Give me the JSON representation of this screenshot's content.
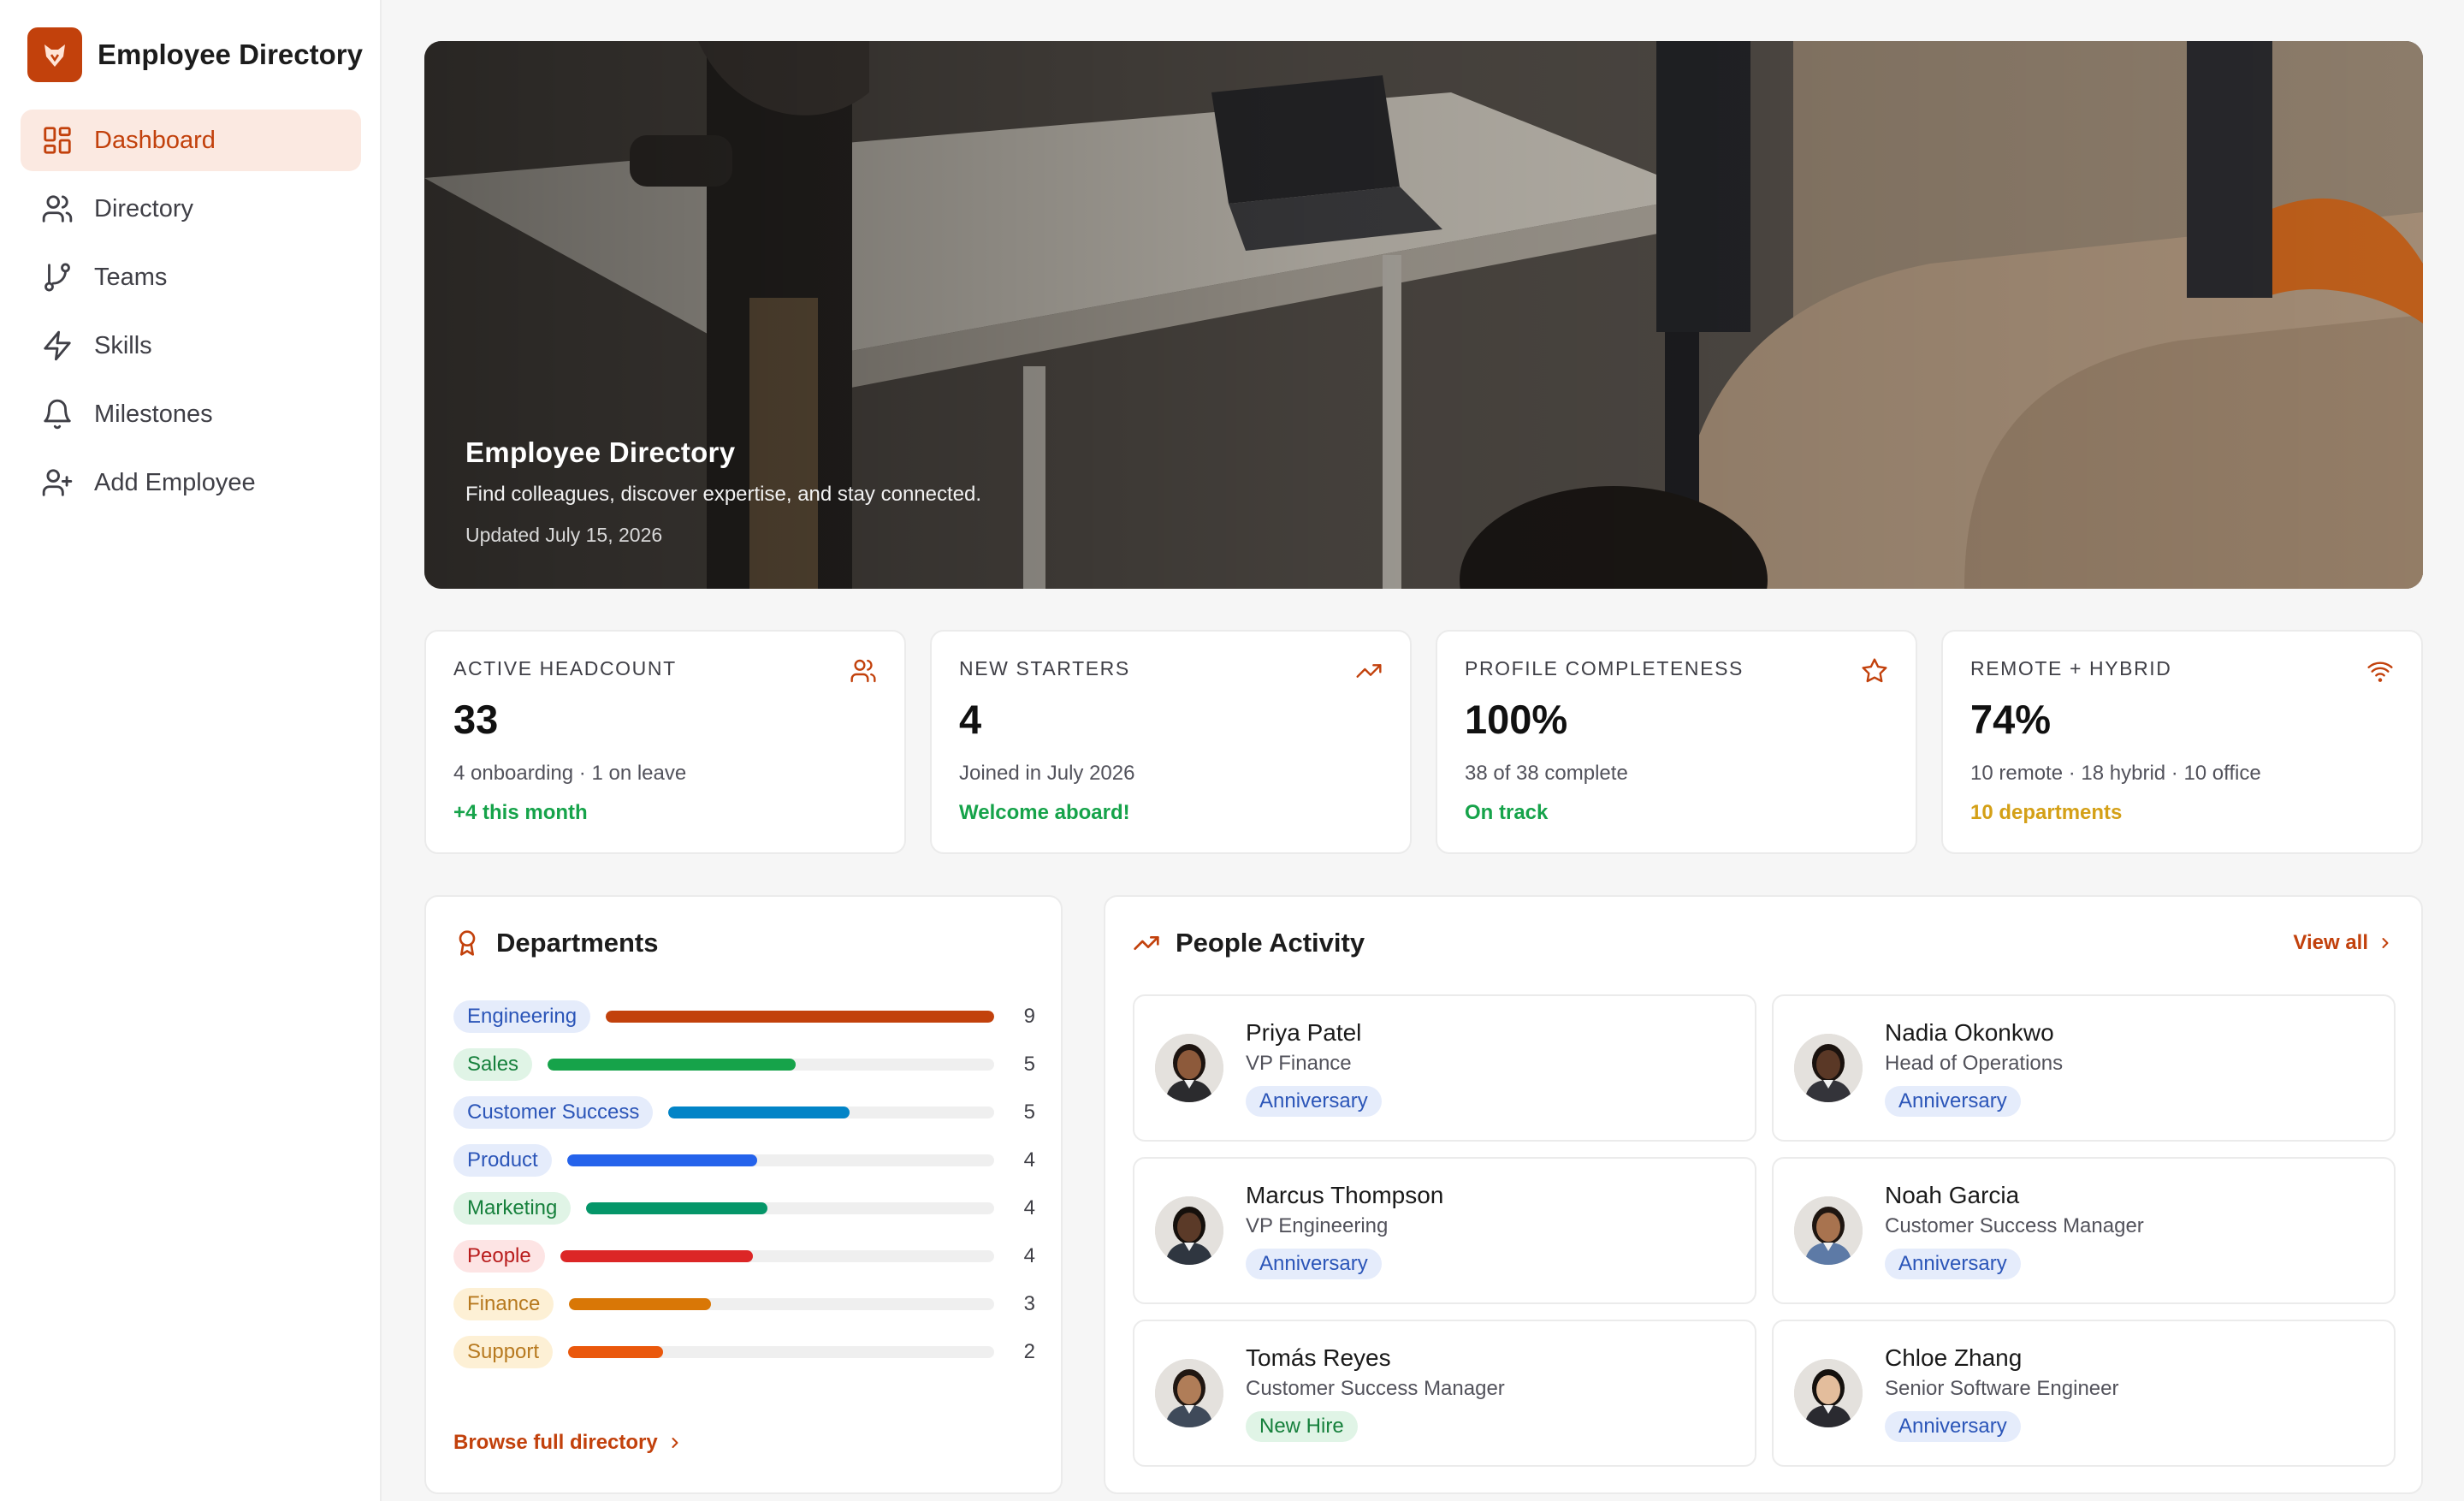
{
  "app": {
    "title": "Employee Directory"
  },
  "sidebar": {
    "items": [
      {
        "label": "Dashboard",
        "icon": "dashboard-icon",
        "active": true
      },
      {
        "label": "Directory",
        "icon": "users-icon"
      },
      {
        "label": "Teams",
        "icon": "git-branch-icon"
      },
      {
        "label": "Skills",
        "icon": "zap-icon"
      },
      {
        "label": "Milestones",
        "icon": "bell-icon"
      },
      {
        "label": "Add Employee",
        "icon": "user-plus-icon"
      }
    ]
  },
  "hero": {
    "title": "Employee Directory",
    "subtitle": "Find colleagues, discover expertise, and stay connected.",
    "updated": "Updated July 15, 2026"
  },
  "stats": [
    {
      "label": "ACTIVE HEADCOUNT",
      "value": "33",
      "detail": "4 onboarding · 1 on leave",
      "note": "+4 this month",
      "note_color": "#16a34a",
      "icon": "users-icon"
    },
    {
      "label": "NEW STARTERS",
      "value": "4",
      "detail": "Joined in July 2026",
      "note": "Welcome aboard!",
      "note_color": "#16a34a",
      "icon": "trending-up-icon"
    },
    {
      "label": "PROFILE COMPLETENESS",
      "value": "100%",
      "detail": "38 of 38 complete",
      "note": "On track",
      "note_color": "#16a34a",
      "icon": "star-icon"
    },
    {
      "label": "REMOTE + HYBRID",
      "value": "74%",
      "detail": "10 remote · 18 hybrid · 10 office",
      "note": "10 departments",
      "note_color": "#d4a017",
      "icon": "wifi-icon"
    }
  ],
  "departments": {
    "title": "Departments",
    "link": "Browse full directory",
    "max": 9,
    "items": [
      {
        "name": "Engineering",
        "count": 9,
        "color": "#c2410c",
        "tag_bg": "#e5ecfb",
        "tag_color": "#2b55b8"
      },
      {
        "name": "Sales",
        "count": 5,
        "color": "#16a34a",
        "tag_bg": "#e0f4e6",
        "tag_color": "#16803c"
      },
      {
        "name": "Customer Success",
        "count": 5,
        "color": "#0284c7",
        "tag_bg": "#e5ecfb",
        "tag_color": "#2b55b8"
      },
      {
        "name": "Product",
        "count": 4,
        "color": "#2563eb",
        "tag_bg": "#e5ecfb",
        "tag_color": "#2b55b8"
      },
      {
        "name": "Marketing",
        "count": 4,
        "color": "#059669",
        "tag_bg": "#e0f4e6",
        "tag_color": "#16803c"
      },
      {
        "name": "People",
        "count": 4,
        "color": "#dc2626",
        "tag_bg": "#fde4e4",
        "tag_color": "#b91c1c"
      },
      {
        "name": "Finance",
        "count": 3,
        "color": "#d97706",
        "tag_bg": "#fdf0d5",
        "tag_color": "#b7791f"
      },
      {
        "name": "Support",
        "count": 2,
        "color": "#ea580c",
        "tag_bg": "#fdf0d5",
        "tag_color": "#b7791f"
      }
    ]
  },
  "activity": {
    "title": "People Activity",
    "view_all": "View all",
    "people": [
      {
        "name": "Priya Patel",
        "role": "VP Finance",
        "badge": "Anniversary",
        "badge_type": "blue",
        "skin": "#8d5a3b",
        "hair": "#1d1410",
        "shirt": "#2b2b2e"
      },
      {
        "name": "Nadia Okonkwo",
        "role": "Head of Operations",
        "badge": "Anniversary",
        "badge_type": "blue",
        "skin": "#5a3826",
        "hair": "#1a120e",
        "shirt": "#34343a"
      },
      {
        "name": "Marcus Thompson",
        "role": "VP Engineering",
        "badge": "Anniversary",
        "badge_type": "blue",
        "skin": "#5b3a28",
        "hair": "#15100c",
        "shirt": "#2f3640"
      },
      {
        "name": "Noah Garcia",
        "role": "Customer Success Manager",
        "badge": "Anniversary",
        "badge_type": "blue",
        "skin": "#a8734f",
        "hair": "#1f1611",
        "shirt": "#5d7aa6"
      },
      {
        "name": "Tomás Reyes",
        "role": "Customer Success Manager",
        "badge": "New Hire",
        "badge_type": "green",
        "skin": "#b07d58",
        "hair": "#201712",
        "shirt": "#3f4a5a"
      },
      {
        "name": "Chloe Zhang",
        "role": "Senior Software Engineer",
        "badge": "Anniversary",
        "badge_type": "blue",
        "skin": "#e3bd9c",
        "hair": "#15110e",
        "shirt": "#2a2a30"
      }
    ]
  }
}
